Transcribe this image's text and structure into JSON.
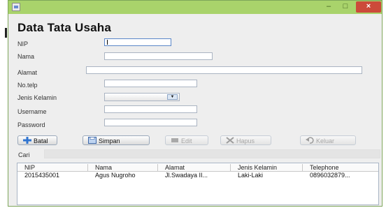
{
  "window": {
    "close_glyph": "×",
    "minimize_glyph": "–",
    "maximize_glyph": "□"
  },
  "form": {
    "title": "Data Tata Usaha",
    "labels": {
      "nip": "NIP",
      "nama": "Nama",
      "alamat": "Alamat",
      "notelp": "No.telp",
      "jenis_kelamin": "Jenis Kelamin",
      "username": "Username",
      "password": "Password"
    },
    "values": {
      "nip": "",
      "nama": "",
      "alamat": "",
      "notelp": "",
      "jenis_kelamin": "",
      "username": "",
      "password": ""
    }
  },
  "buttons": {
    "batal": "Batal",
    "simpan": "Simpan",
    "edit": "Edit",
    "hapus": "Hapus",
    "keluar": "Keluar"
  },
  "search": {
    "label": "Cari",
    "value": ""
  },
  "table": {
    "headers": [
      "NIP",
      "Nama",
      "Alamat",
      "Jenis Kelamin",
      "Telephone"
    ],
    "rows": [
      [
        "2015435001",
        "Agus Nugroho",
        "Jl.Swadaya II...",
        "Laki-Laki",
        "0896032879..."
      ]
    ]
  },
  "colors": {
    "titlebar": "#a9d36b",
    "close_button": "#cc4a3a",
    "window_bg": "#eeeeee"
  }
}
